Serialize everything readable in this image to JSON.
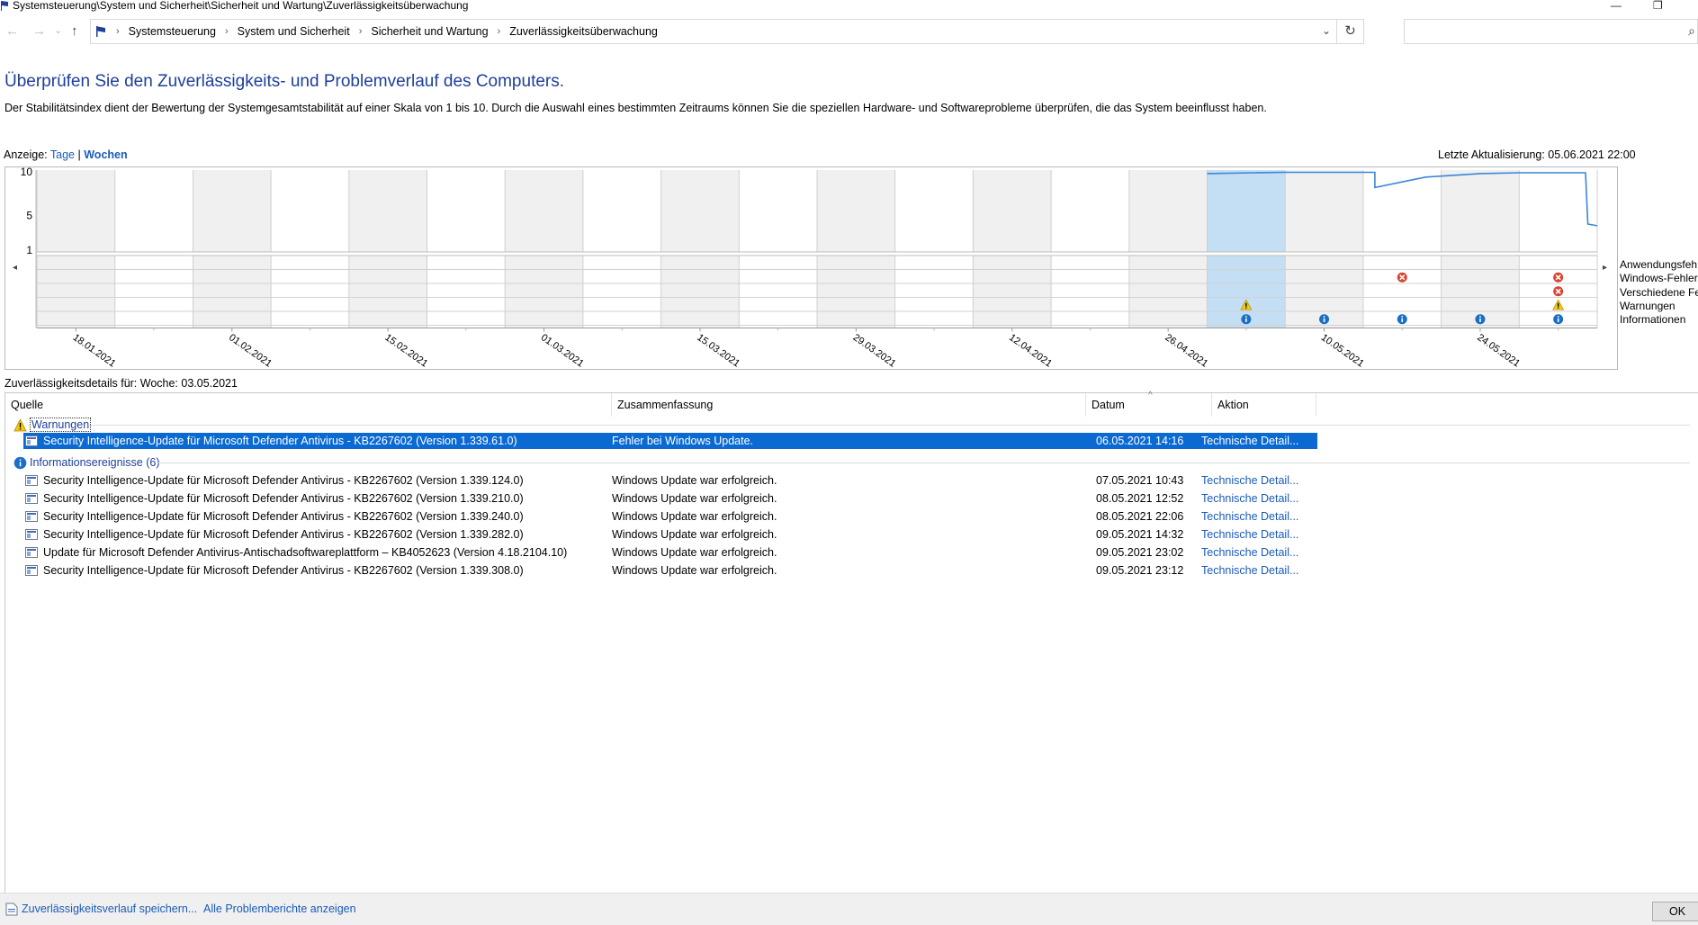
{
  "window": {
    "title": "Systemsteuerung\\System und Sicherheit\\Sicherheit und Wartung\\Zuverlässigkeitsüberwachung",
    "minimize_glyph": "—",
    "restore_glyph": "❐"
  },
  "nav": {
    "back_glyph": "←",
    "forward_glyph": "→",
    "history_glyph": "⌄",
    "up_glyph": "↑",
    "breadcrumb": [
      "Systemsteuerung",
      "System und Sicherheit",
      "Sicherheit und Wartung",
      "Zuverlässigkeitsüberwachung"
    ],
    "separator": "›",
    "dropdown_glyph": "⌄",
    "refresh_glyph": "↻",
    "search_placeholder": "",
    "search_glyph": "⌕"
  },
  "header": {
    "heading": "Überprüfen Sie den Zuverlässigkeits- und Problemverlauf des Computers.",
    "description": "Der Stabilitätsindex dient der Bewertung der Systemgesamtstabilität auf einer Skala von 1 bis 10. Durch die Auswahl eines bestimmten Zeitraums können Sie die speziellen Hardware- und Softwareprobleme überprüfen, die das System beeinflusst haben.",
    "view_label": "Anzeige:",
    "view_days": "Tage",
    "view_separator": "|",
    "view_weeks": "Wochen",
    "last_update": "Letzte Aktualisierung: 05.06.2021 22:00"
  },
  "chart_data": {
    "type": "line",
    "y_ticks": [
      "10",
      "5",
      "1"
    ],
    "ylim": [
      1,
      10
    ],
    "columns": 20,
    "selected_column": 15,
    "x_tick_labels": [
      "18.01.2021",
      "01.02.2021",
      "15.02.2021",
      "01.03.2021",
      "15.03.2021",
      "29.03.2021",
      "12.04.2021",
      "26.04.2021",
      "10.05.2021",
      "24.05.2021"
    ],
    "stability_line": [
      {
        "x": 15.0,
        "y": 9.8
      },
      {
        "x": 15.6,
        "y": 9.9
      },
      {
        "x": 16.0,
        "y": 9.95
      },
      {
        "x": 17.15,
        "y": 9.95
      },
      {
        "x": 17.15,
        "y": 8.2
      },
      {
        "x": 17.8,
        "y": 9.4
      },
      {
        "x": 18.5,
        "y": 9.8
      },
      {
        "x": 19.0,
        "y": 9.9
      },
      {
        "x": 19.85,
        "y": 9.9
      },
      {
        "x": 19.88,
        "y": 4.0
      },
      {
        "x": 20.0,
        "y": 3.8
      }
    ],
    "event_rows": [
      "Anwendungsfehler",
      "Windows-Fehler",
      "Verschiedene Fehler",
      "Warnungen",
      "Informationen"
    ],
    "event_row_labels_shown": [
      "Anwendungsfeh",
      "Windows-Fehler",
      "Verschiedene Fel",
      "Warnungen",
      "Informationen"
    ],
    "events": [
      {
        "column": 15,
        "row": "Warnungen",
        "kind": "warning"
      },
      {
        "column": 15,
        "row": "Informationen",
        "kind": "info"
      },
      {
        "column": 16,
        "row": "Informationen",
        "kind": "info"
      },
      {
        "column": 17,
        "row": "Windows-Fehler",
        "kind": "error"
      },
      {
        "column": 17,
        "row": "Informationen",
        "kind": "info"
      },
      {
        "column": 18,
        "row": "Informationen",
        "kind": "info"
      },
      {
        "column": 19,
        "row": "Windows-Fehler",
        "kind": "error"
      },
      {
        "column": 19,
        "row": "Verschiedene Fehler",
        "kind": "error"
      },
      {
        "column": 19,
        "row": "Warnungen",
        "kind": "warning"
      },
      {
        "column": 19,
        "row": "Informationen",
        "kind": "info"
      }
    ],
    "scroll_left_glyph": "◂",
    "scroll_right_glyph": "▸",
    "colors": {
      "line": "#3b86d6",
      "selected": "#c4def4",
      "shaded": "#f0f0f0",
      "error": "#d9432f",
      "warning": "#f2c811",
      "info": "#1a6fc4"
    }
  },
  "details": {
    "label": "Zuverlässigkeitsdetails für: Woche: 03.05.2021",
    "columns": [
      "Quelle",
      "Zusammenfassung",
      "Datum",
      "Aktion"
    ],
    "sort_glyph": "^",
    "warnings_group": "Warnungen",
    "warnings": [
      {
        "source": "Security Intelligence-Update für Microsoft Defender Antivirus - KB2267602 (Version 1.339.61.0)",
        "summary": "Fehler bei Windows Update.",
        "date": "06.05.2021 14:16",
        "action": "Technische Detail..."
      }
    ],
    "info_group": "Informationsereignisse (6)",
    "info": [
      {
        "source": "Security Intelligence-Update für Microsoft Defender Antivirus - KB2267602 (Version 1.339.124.0)",
        "summary": "Windows Update war erfolgreich.",
        "date": "07.05.2021 10:43",
        "action": "Technische Detail..."
      },
      {
        "source": "Security Intelligence-Update für Microsoft Defender Antivirus - KB2267602 (Version 1.339.210.0)",
        "summary": "Windows Update war erfolgreich.",
        "date": "08.05.2021 12:52",
        "action": "Technische Detail..."
      },
      {
        "source": "Security Intelligence-Update für Microsoft Defender Antivirus - KB2267602 (Version 1.339.240.0)",
        "summary": "Windows Update war erfolgreich.",
        "date": "08.05.2021 22:06",
        "action": "Technische Detail..."
      },
      {
        "source": "Security Intelligence-Update für Microsoft Defender Antivirus - KB2267602 (Version 1.339.282.0)",
        "summary": "Windows Update war erfolgreich.",
        "date": "09.05.2021 14:32",
        "action": "Technische Detail..."
      },
      {
        "source": "Update für Microsoft Defender Antivirus-Antischadsoftwareplattform – KB4052623 (Version 4.18.2104.10)",
        "summary": "Windows Update war erfolgreich.",
        "date": "09.05.2021 23:02",
        "action": "Technische Detail..."
      },
      {
        "source": "Security Intelligence-Update für Microsoft Defender Antivirus - KB2267602 (Version 1.339.308.0)",
        "summary": "Windows Update war erfolgreich.",
        "date": "09.05.2021 23:12",
        "action": "Technische Detail..."
      }
    ]
  },
  "footer": {
    "save_history": "Zuverlässigkeitsverlauf speichern...",
    "all_reports": "Alle Problemberichte anzeigen",
    "ok": "OK"
  }
}
